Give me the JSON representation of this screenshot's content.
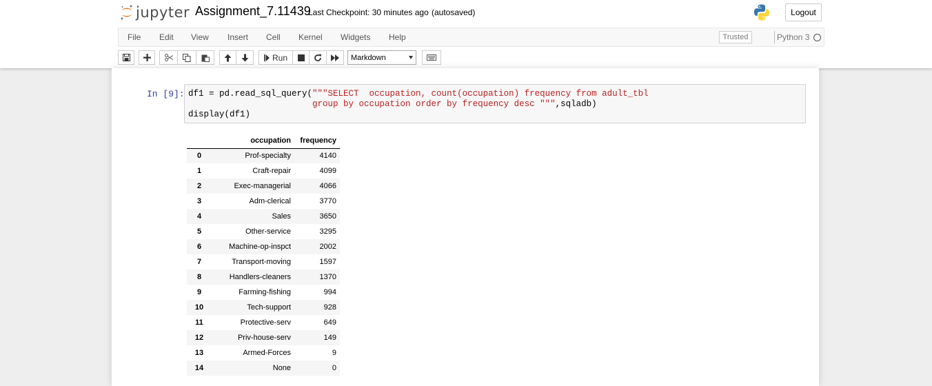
{
  "header": {
    "logo_text": "jupyter",
    "notebook_name": "Assignment_7.11439",
    "checkpoint": "Last Checkpoint: 30 minutes ago",
    "autosave": "(autosaved)",
    "logout_label": "Logout"
  },
  "menubar": {
    "items": [
      "File",
      "Edit",
      "View",
      "Insert",
      "Cell",
      "Kernel",
      "Widgets",
      "Help"
    ],
    "trusted": "Trusted",
    "kernel_name": "Python 3"
  },
  "toolbar": {
    "run_label": "Run",
    "cell_type": "Markdown"
  },
  "cell": {
    "prompt": "In [9]:",
    "code": {
      "line1_pre": "df1 = pd.read_sql_query(",
      "line1_str": "\"\"\"SELECT  occupation, count(occupation) frequency from adult_tbl",
      "line2_str": "                        group by occupation order by frequency desc \"\"\"",
      "line2_post": ",sqladb)",
      "line3": "display(df1)"
    }
  },
  "dataframe": {
    "columns": [
      "",
      "occupation",
      "frequency"
    ],
    "rows": [
      {
        "index": "0",
        "occupation": "Prof-specialty",
        "frequency": "4140"
      },
      {
        "index": "1",
        "occupation": "Craft-repair",
        "frequency": "4099"
      },
      {
        "index": "2",
        "occupation": "Exec-managerial",
        "frequency": "4066"
      },
      {
        "index": "3",
        "occupation": "Adm-clerical",
        "frequency": "3770"
      },
      {
        "index": "4",
        "occupation": "Sales",
        "frequency": "3650"
      },
      {
        "index": "5",
        "occupation": "Other-service",
        "frequency": "3295"
      },
      {
        "index": "6",
        "occupation": "Machine-op-inspct",
        "frequency": "2002"
      },
      {
        "index": "7",
        "occupation": "Transport-moving",
        "frequency": "1597"
      },
      {
        "index": "8",
        "occupation": "Handlers-cleaners",
        "frequency": "1370"
      },
      {
        "index": "9",
        "occupation": "Farming-fishing",
        "frequency": "994"
      },
      {
        "index": "10",
        "occupation": "Tech-support",
        "frequency": "928"
      },
      {
        "index": "11",
        "occupation": "Protective-serv",
        "frequency": "649"
      },
      {
        "index": "12",
        "occupation": "Priv-house-serv",
        "frequency": "149"
      },
      {
        "index": "13",
        "occupation": "Armed-Forces",
        "frequency": "9"
      },
      {
        "index": "14",
        "occupation": "None",
        "frequency": "0"
      }
    ]
  },
  "colors": {
    "prompt": "#303f9f",
    "string": "#ba2121",
    "logo_orange": "#f37726"
  },
  "icons": [
    "jupyter-logo",
    "python-logo",
    "save-icon",
    "plus-icon",
    "cut-icon",
    "copy-icon",
    "paste-icon",
    "arrow-up-icon",
    "arrow-down-icon",
    "step-icon",
    "stop-icon",
    "restart-icon",
    "fast-forward-icon",
    "keyboard-icon"
  ]
}
